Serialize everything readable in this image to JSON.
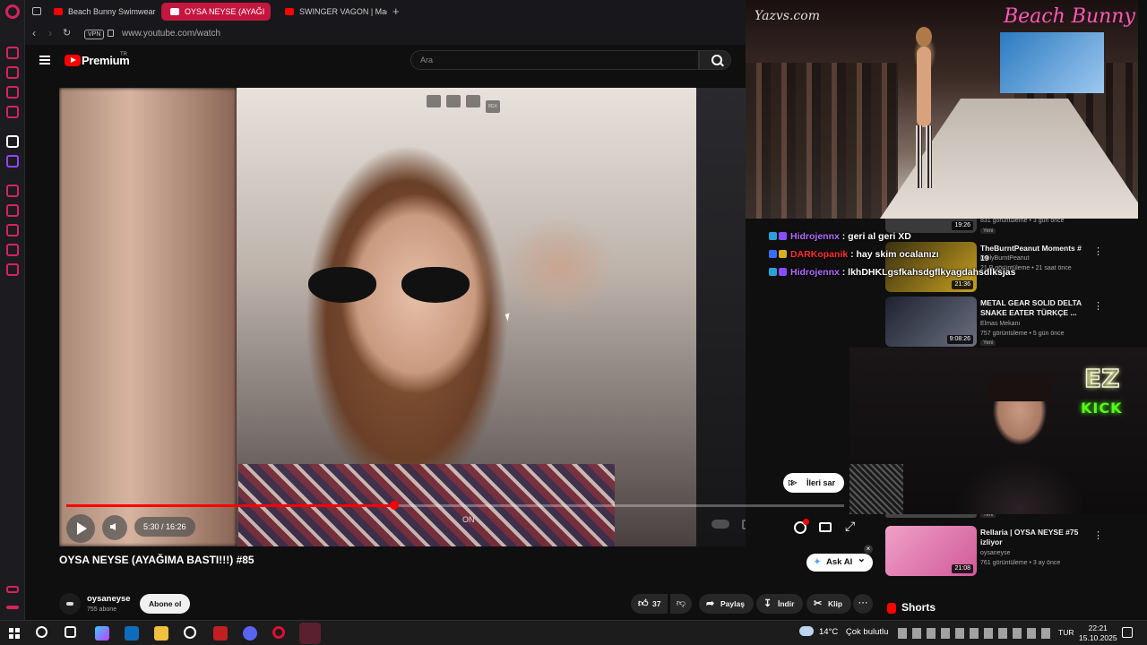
{
  "browser": {
    "tabs": [
      {
        "label": "Beach Bunny Swimwear F",
        "active": false
      },
      {
        "label": "OYSA NEYSE (AYAĞI",
        "active": true
      },
      {
        "label": "SWINGER VAGON | Mada",
        "active": false
      }
    ],
    "new_tab": "+",
    "vpn": "VPN",
    "url": "www.youtube.com/watch"
  },
  "yt": {
    "brand": "Premium",
    "region": "TR",
    "search_placeholder": "Ara"
  },
  "player": {
    "progress": 0.422,
    "time": "5:30 / 16:26",
    "autoplay_hint": "ON",
    "hover_ctrl_label": "8GX",
    "skip_label": "İleri sar"
  },
  "video": {
    "title": "OYSA NEYSE (AYAĞIMA BASTI!!!) #85",
    "ask_ai": "Ask AI",
    "channel": "oysaneyse",
    "subscribers": "755 abone",
    "subscribe": "Abone ol",
    "likes": "37",
    "share": "Paylaş",
    "download": "İndir",
    "clip": "Klip",
    "more": "⋯"
  },
  "recommendations": [
    {
      "title": "",
      "channel": "",
      "meta": "831 görüntüleme • 3 gün önce",
      "duration": "19:26",
      "badge": "Yeni",
      "thumb": "#3a3a3a"
    },
    {
      "title": "TheBurntPeanut Moments # 19",
      "channel": "DailyBurntPeanut",
      "meta": "21 B görüntüleme • 21 saat önce",
      "duration": "21:36",
      "badge": "Yeni",
      "thumb": "#c8a020"
    },
    {
      "title": "METAL GEAR SOLID DELTA SNAKE EATER TÜRKÇE ...",
      "channel": "Elmas Mekanı",
      "meta": "757 görüntüleme • 5 gün önce",
      "duration": "9:08:26",
      "badge": "Yeni",
      "thumb": "#5a6070"
    },
    {
      "title": "Rellaria | OYSA NEYSE #75 izliyor",
      "channel": "oysaneyse",
      "meta": "761 görüntüleme • 3 ay önce",
      "duration": "21:08",
      "badge": "",
      "thumb": "#d05a98"
    }
  ],
  "partial_badge": "Yeni",
  "shorts_title": "Shorts",
  "runway": {
    "logo": "Yazvs.com",
    "brand": "Beach Bunny"
  },
  "chat": [
    {
      "user": "Hidrojennx",
      "msg": ": geri al geri XD",
      "color": "#b36cff",
      "badge1": "#2aa0d8",
      "badge2": "#8a4cff"
    },
    {
      "user": "DARKopanik",
      "msg": ": hay skim ocalanızı",
      "color": "#ff3030",
      "badge1": "#3a6cff",
      "badge2": "#d8b020"
    },
    {
      "user": "Hidrojennx",
      "msg": ": lkhDHKLgsfkahsdgflkyagdahsdlksjas",
      "color": "#b36cff",
      "badge1": "#2aa0d8",
      "badge2": "#8a4cff"
    }
  ],
  "webcam": {
    "sign1": "EZ",
    "sign2": "KICK"
  },
  "taskbar": {
    "weather_temp": "14°C",
    "weather_desc": "Çok bulutlu",
    "lang": "TUR",
    "time": "22:21",
    "date": "15.10.2025"
  },
  "colors": {
    "accent": "#c4163f",
    "yt_red": "#ff0000",
    "opera": "#d6245d"
  }
}
